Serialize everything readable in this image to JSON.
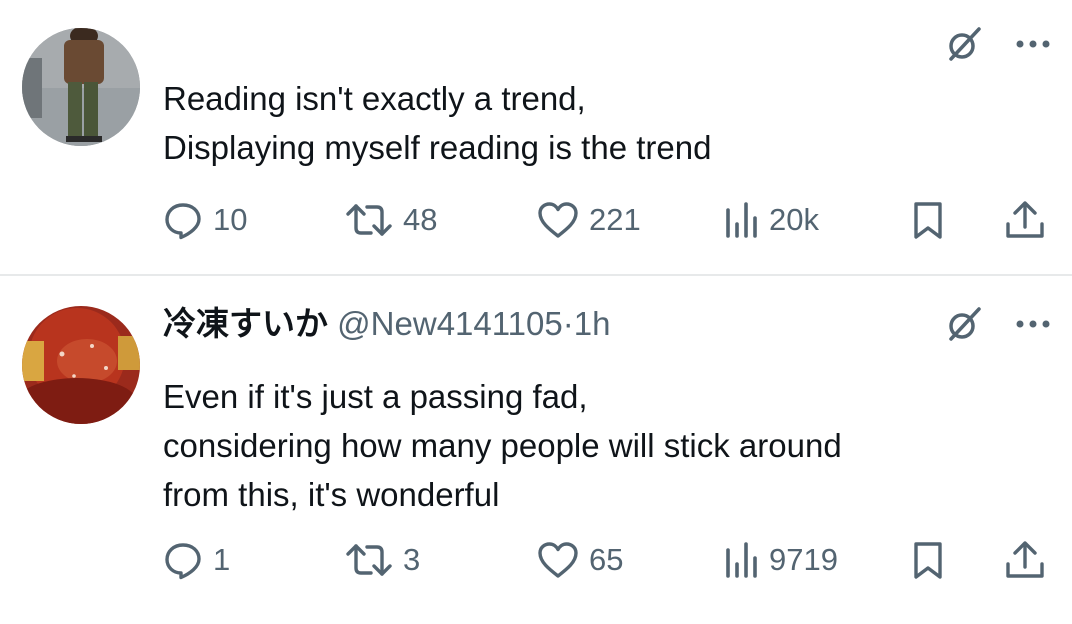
{
  "posts": [
    {
      "name": "",
      "handle": "",
      "time": "",
      "lines": [
        "Reading isn't exactly a trend,",
        "Displaying myself reading is the trend"
      ],
      "stats": {
        "replies": "10",
        "reposts": "48",
        "likes": "221",
        "views": "20k"
      }
    },
    {
      "name": "冷凍すいか",
      "handle": "@New4141105",
      "dot": "·",
      "time": "1h",
      "lines": [
        "Even if it's just a passing fad,",
        "considering how many people will stick around",
        "from this, it's wonderful"
      ],
      "stats": {
        "replies": "1",
        "reposts": "3",
        "likes": "65",
        "views": "9719"
      }
    }
  ],
  "icons": {
    "reply": "reply-icon",
    "repost": "repost-icon",
    "like": "heart-icon",
    "views": "views-icon",
    "bookmark": "bookmark-icon",
    "share": "share-icon",
    "grok": "grok-icon",
    "more": "more-icon"
  },
  "colors": {
    "text": "#0f1419",
    "secondary": "#536471",
    "divider": "#e7e9ea"
  }
}
